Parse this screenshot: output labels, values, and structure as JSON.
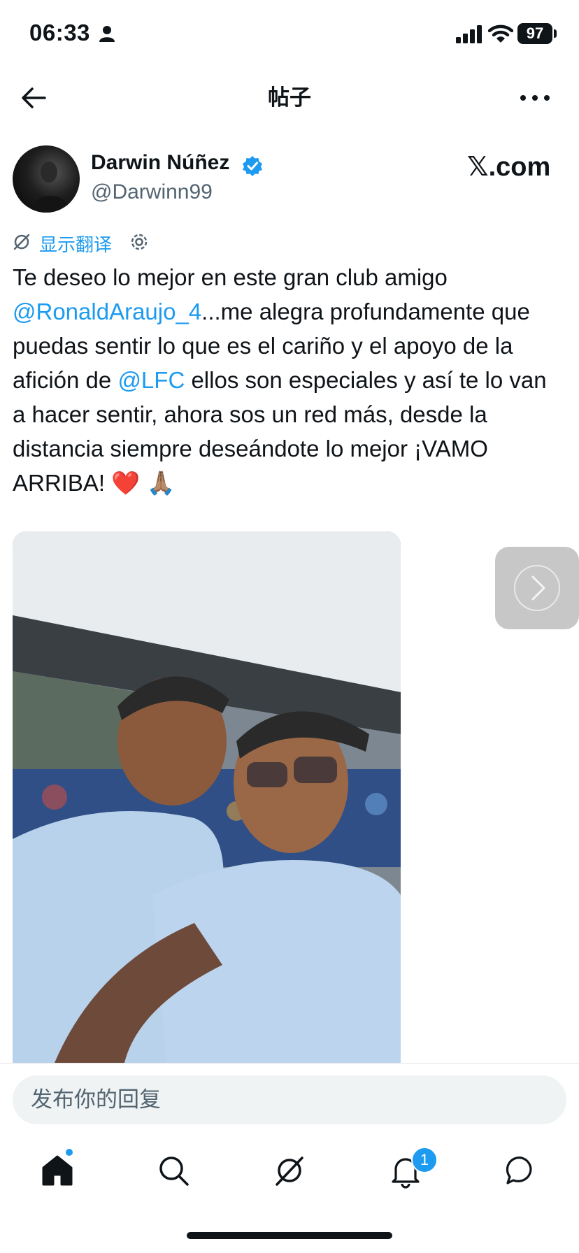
{
  "status_bar": {
    "time": "06:33",
    "battery": "97"
  },
  "header": {
    "title": "帖子"
  },
  "author": {
    "name": "Darwin Núñez",
    "handle": "@Darwinn99"
  },
  "watermark": "𝕏.com",
  "translate": {
    "label": "显示翻译"
  },
  "tweet": {
    "text_1": "Te deseo lo mejor en este gran club amigo ",
    "mention_1": "@RonaldAraujo_4",
    "text_2": "...me alegra profundamente que puedas sentir lo que es el cariño y el apoyo de la afición de ",
    "mention_2": "@LFC",
    "text_3": " ellos son especiales y así te lo van a hacer sentir, ahora sos un red más, desde la distancia siempre deseándote lo mejor ¡VAMO ARRIBA! ❤️ 🙏🏽"
  },
  "reply": {
    "placeholder": "发布你的回复"
  },
  "tabbar": {
    "notification_count": "1"
  },
  "colors": {
    "accent": "#1d9bf0",
    "text": "#0f1419",
    "secondary": "#536471"
  }
}
